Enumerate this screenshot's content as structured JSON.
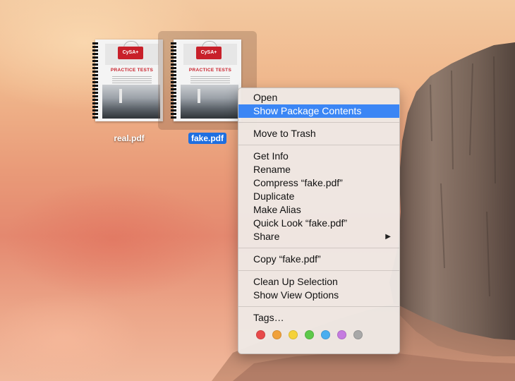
{
  "desktop": {
    "icons": [
      {
        "label": "real.pdf",
        "selected": false,
        "doc": {
          "badge": "CySA+",
          "subtitle": "PRACTICE TESTS"
        }
      },
      {
        "label": "fake.pdf",
        "selected": true,
        "doc": {
          "badge": "CySA+",
          "subtitle": "PRACTICE TESTS"
        }
      }
    ]
  },
  "context_menu": {
    "groups": [
      [
        "Open",
        "Show Package Contents"
      ],
      [
        "Move to Trash"
      ],
      [
        "Get Info",
        "Rename",
        "Compress “fake.pdf”",
        "Duplicate",
        "Make Alias",
        "Quick Look “fake.pdf”",
        "Share"
      ],
      [
        "Copy “fake.pdf”"
      ],
      [
        "Clean Up Selection",
        "Show View Options"
      ],
      [
        "Tags…"
      ]
    ],
    "highlighted": "Show Package Contents",
    "submenu_items": [
      "Share"
    ],
    "tag_colors": [
      "#e84a4a",
      "#f0a13b",
      "#f5d23a",
      "#5dc94a",
      "#4aaef0",
      "#c57be0",
      "#a8a8a8"
    ]
  }
}
